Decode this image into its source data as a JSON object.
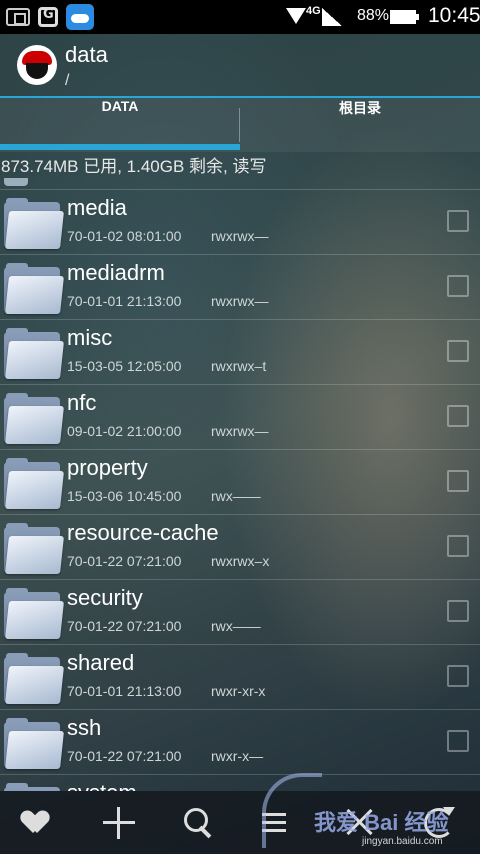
{
  "status_bar": {
    "net_type": "4G",
    "battery_pct": "88%",
    "time": "10:45",
    "icons": [
      "screenshot-icon",
      "shield-g-icon",
      "cloud-icon",
      "wifi-icon",
      "signal-icon",
      "battery-icon"
    ]
  },
  "header": {
    "title": "data",
    "path": "/"
  },
  "tabs": [
    {
      "label": "DATA",
      "selected": true
    },
    {
      "label": "根目录",
      "selected": false
    }
  ],
  "storage_info": "873.74MB 已用, 1.40GB 剩余, 读写",
  "files": [
    {
      "name": "media",
      "date": "70-01-02 08:01:00",
      "perm": "rwxrwx—"
    },
    {
      "name": "mediadrm",
      "date": "70-01-01 21:13:00",
      "perm": "rwxrwx—"
    },
    {
      "name": "misc",
      "date": "15-03-05 12:05:00",
      "perm": "rwxrwx–t"
    },
    {
      "name": "nfc",
      "date": "09-01-02 21:00:00",
      "perm": "rwxrwx—"
    },
    {
      "name": "property",
      "date": "15-03-06 10:45:00",
      "perm": "rwx——"
    },
    {
      "name": "resource-cache",
      "date": "70-01-22 07:21:00",
      "perm": "rwxrwx–x"
    },
    {
      "name": "security",
      "date": "70-01-22 07:21:00",
      "perm": "rwx——"
    },
    {
      "name": "shared",
      "date": "70-01-01 21:13:00",
      "perm": "rwxr-xr-x"
    },
    {
      "name": "ssh",
      "date": "70-01-22 07:21:00",
      "perm": "rwxr-x—"
    },
    {
      "name": "system",
      "date": "",
      "perm": ""
    }
  ],
  "bottom_bar": [
    "favorite-icon",
    "add-icon",
    "search-icon",
    "sort-icon",
    "close-icon",
    "refresh-icon"
  ],
  "watermark": {
    "text": "我爱 Bai 经验",
    "url": "jingyan.baidu.com"
  },
  "colors": {
    "accent": "#2aa6d6",
    "status_bar": "#000000"
  }
}
